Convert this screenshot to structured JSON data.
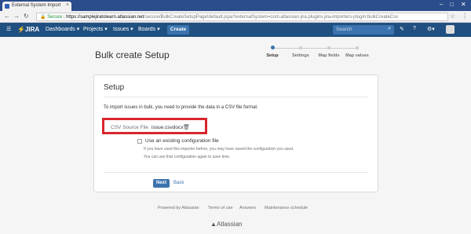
{
  "browser": {
    "tab_title": "External System Import",
    "tab_close": "×",
    "win_minimize": "–",
    "win_maximize": "□",
    "win_close": "✕",
    "secure_label": "Secure",
    "url_host": "https://samplejiratolearn.atlassian.net",
    "url_path": "/secure/BulkCreateSetupPage!default.jspa?externalSystem=com.atlassian.jira.plugins.jira-importers-plugin:bulkCreateCsv"
  },
  "jira": {
    "logo": "JIRA",
    "nav": [
      "Dashboards ▾",
      "Projects ▾",
      "Issues ▾",
      "Boards ▾"
    ],
    "create_label": "Create",
    "search_placeholder": "Search"
  },
  "page": {
    "title": "Bulk create Setup",
    "steps": [
      {
        "label": "Setup",
        "active": true
      },
      {
        "label": "Settings",
        "active": false
      },
      {
        "label": "Map fields",
        "active": false
      },
      {
        "label": "Map values",
        "active": false
      }
    ]
  },
  "setup": {
    "heading": "Setup",
    "intro": "To import issues in bulk, you need to provide the data in a CSV file format.",
    "file_label": "CSV Source File",
    "file_name": "issue.csvdocx",
    "checkbox_label": "Use an existing configuration file",
    "help_line_1": "If you have used this importer before, you may have saved the configuration you used.",
    "help_line_2": "You can use that configuration again to save time.",
    "next_label": "Next",
    "back_label": "Back"
  },
  "footer": {
    "links": [
      "Powered by Atlassian",
      "Terms of use",
      "Answers",
      "Maintenance schedule"
    ],
    "brand": "Atlassian"
  },
  "colors": {
    "header": "#205081",
    "accent": "#3b73af",
    "highlight": "#d9262d"
  }
}
